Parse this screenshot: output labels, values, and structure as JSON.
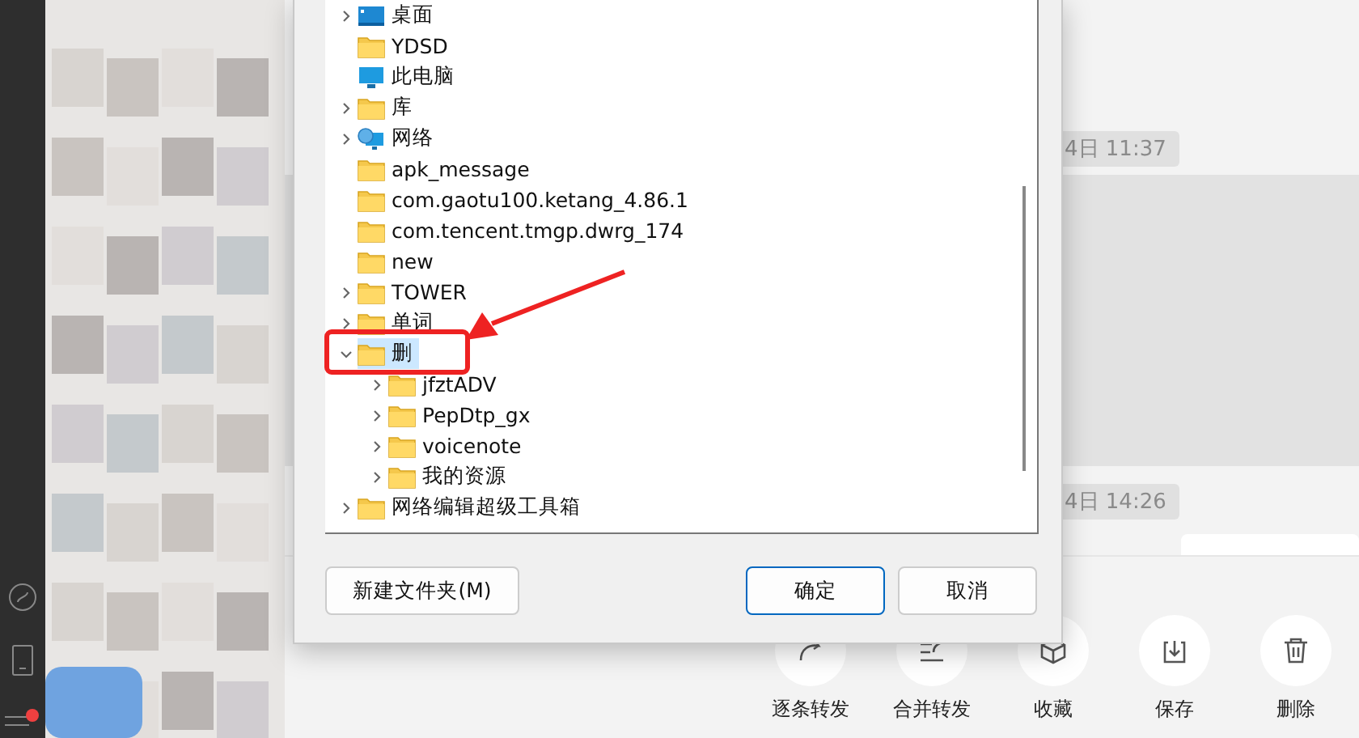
{
  "messages": {
    "timestamps": [
      "4日 11:37",
      "4日 14:26"
    ]
  },
  "dialog": {
    "tree": [
      {
        "label": "桌面",
        "kind": "desktop",
        "expanded": false,
        "selected": false
      },
      {
        "label": "YDSD",
        "kind": "folder",
        "selected": false
      },
      {
        "label": "此电脑",
        "kind": "pc",
        "selected": false
      },
      {
        "label": "库",
        "kind": "folder",
        "expanded": false,
        "selected": false
      },
      {
        "label": "网络",
        "kind": "network",
        "expanded": false,
        "selected": false
      },
      {
        "label": "apk_message",
        "kind": "folder",
        "selected": false
      },
      {
        "label": "com.gaotu100.ketang_4.86.1",
        "kind": "folder",
        "selected": false
      },
      {
        "label": "com.tencent.tmgp.dwrg_174",
        "kind": "folder",
        "selected": false
      },
      {
        "label": "new",
        "kind": "folder",
        "selected": false
      },
      {
        "label": "TOWER",
        "kind": "folder",
        "expanded": false,
        "selected": false
      },
      {
        "label": "单词",
        "kind": "folder",
        "expanded": false,
        "selected": false
      },
      {
        "label": "删",
        "kind": "folder",
        "expanded": true,
        "selected": true,
        "children": [
          {
            "label": "jfztADV",
            "kind": "folder",
            "expanded": false,
            "selected": false
          },
          {
            "label": "PepDtp_gx",
            "kind": "folder",
            "expanded": false,
            "selected": false
          },
          {
            "label": "voicenote",
            "kind": "folder",
            "expanded": false,
            "selected": false
          },
          {
            "label": "我的资源",
            "kind": "folder",
            "expanded": false,
            "selected": false
          }
        ]
      },
      {
        "label": "网络编辑超级工具箱",
        "kind": "folder",
        "expanded": false,
        "selected": false
      }
    ],
    "buttons": [
      {
        "label": "新建文件夹(M)",
        "default": false
      },
      {
        "label": "确定",
        "default": true
      },
      {
        "label": "取消",
        "default": false
      }
    ]
  },
  "toolbar": [
    {
      "label": "逐条转发",
      "kind": "forward"
    },
    {
      "label": "合并转发",
      "kind": "merge"
    },
    {
      "label": "收藏",
      "kind": "collect"
    },
    {
      "label": "保存",
      "kind": "save"
    },
    {
      "label": "删除",
      "kind": "delete"
    }
  ]
}
